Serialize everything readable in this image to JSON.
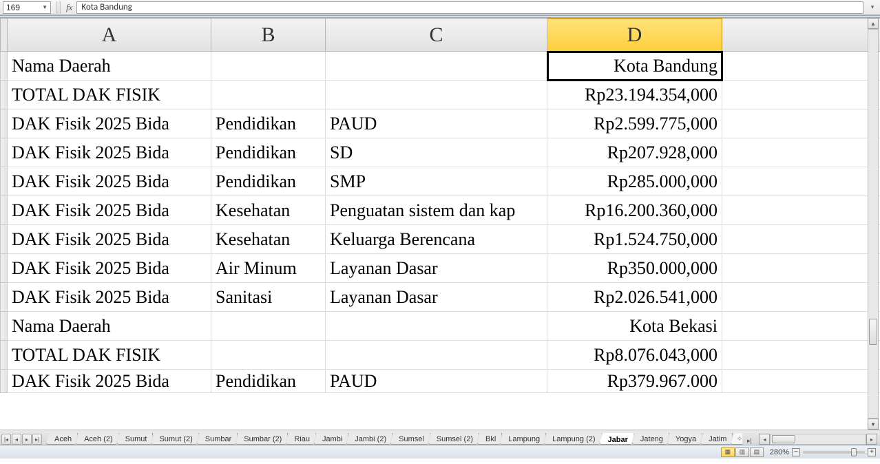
{
  "formula_bar": {
    "name_box": "169",
    "fx_label": "fx",
    "formula": "Kota Bandung"
  },
  "columns": [
    "A",
    "B",
    "C",
    "D"
  ],
  "selected_column_index": 3,
  "selected_cell": {
    "row": 0,
    "col": 3
  },
  "rows": [
    {
      "A": "Nama Daerah",
      "B": "",
      "C": "",
      "D": "Kota Bandung"
    },
    {
      "A": "TOTAL DAK FISIK",
      "B": "",
      "C": "",
      "D": "Rp23.194.354,000"
    },
    {
      "A": "DAK Fisik 2025 Bida",
      "B": "Pendidikan",
      "C": "PAUD",
      "D": "Rp2.599.775,000"
    },
    {
      "A": "DAK Fisik 2025 Bida",
      "B": "Pendidikan",
      "C": "SD",
      "D": "Rp207.928,000"
    },
    {
      "A": "DAK Fisik 2025 Bida",
      "B": "Pendidikan",
      "C": "SMP",
      "D": "Rp285.000,000"
    },
    {
      "A": "DAK Fisik 2025 Bida",
      "B": "Kesehatan",
      "C": "Penguatan sistem dan kap",
      "D": "Rp16.200.360,000"
    },
    {
      "A": "DAK Fisik 2025 Bida",
      "B": "Kesehatan",
      "C": "Keluarga Berencana",
      "D": "Rp1.524.750,000"
    },
    {
      "A": "DAK Fisik 2025 Bida",
      "B": "Air Minum",
      "C": "Layanan Dasar",
      "D": "Rp350.000,000"
    },
    {
      "A": "DAK Fisik 2025 Bida",
      "B": "Sanitasi",
      "C": "Layanan Dasar",
      "D": "Rp2.026.541,000"
    },
    {
      "A": "Nama Daerah",
      "B": "",
      "C": "",
      "D": "Kota Bekasi"
    },
    {
      "A": "TOTAL DAK FISIK",
      "B": "",
      "C": "",
      "D": "Rp8.076.043,000"
    },
    {
      "A": "DAK Fisik 2025 Bida",
      "B": "Pendidikan",
      "C": "PAUD",
      "D": "Rp379.967.000"
    }
  ],
  "sheet_tabs": {
    "tabs": [
      "Aceh",
      "Aceh (2)",
      "Sumut",
      "Sumut (2)",
      "Sumbar",
      "Sumbar (2)",
      "Riau",
      "Jambi",
      "Jambi (2)",
      "Sumsel",
      "Sumsel (2)",
      "Bkl",
      "Lampung",
      "Lampung (2)",
      "Jabar",
      "Jateng",
      "Yogya",
      "Jatim"
    ],
    "active": "Jabar"
  },
  "status": {
    "zoom_label": "280%",
    "zoom_thumb_pct": 78
  }
}
